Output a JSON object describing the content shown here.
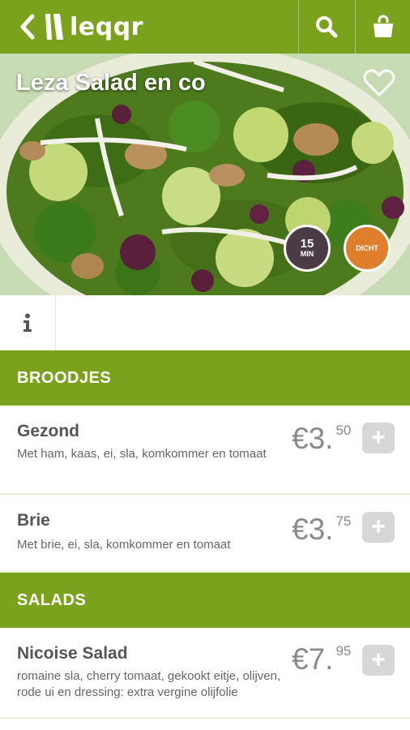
{
  "header": {
    "brand": "leqqr",
    "back_icon": "chevron-left-icon",
    "search_icon": "search-icon",
    "cart_icon": "shopping-bag-icon",
    "background_color": "#7ba21d"
  },
  "restaurant": {
    "name": "Leza Salad en co",
    "favorite_icon": "heart-icon",
    "delivery_time": {
      "value": "15",
      "unit": "MIN"
    },
    "status": "DICHT",
    "status_color": "#e07f2b"
  },
  "tabs": {
    "info_icon": "info-icon"
  },
  "menu": {
    "sections": [
      {
        "title": "BROODJES",
        "items": [
          {
            "name": "Gezond",
            "description": "Met ham, kaas, ei, sla, komkommer en tomaat",
            "price_main": "€3.",
            "price_cents": "50",
            "add_label": "+"
          },
          {
            "name": "Brie",
            "description": "Met brie, ei, sla, komkommer en tomaat",
            "price_main": "€3.",
            "price_cents": "75",
            "add_label": "+"
          }
        ]
      },
      {
        "title": "SALADS",
        "items": [
          {
            "name": "Nicoise Salad",
            "description": "romaine sla, cherry tomaat, gekookt eitje, olijven, rode ui en dressing: extra vergine olijfolie",
            "price_main": "€7.",
            "price_cents": "95",
            "add_label": "+"
          }
        ]
      }
    ]
  }
}
